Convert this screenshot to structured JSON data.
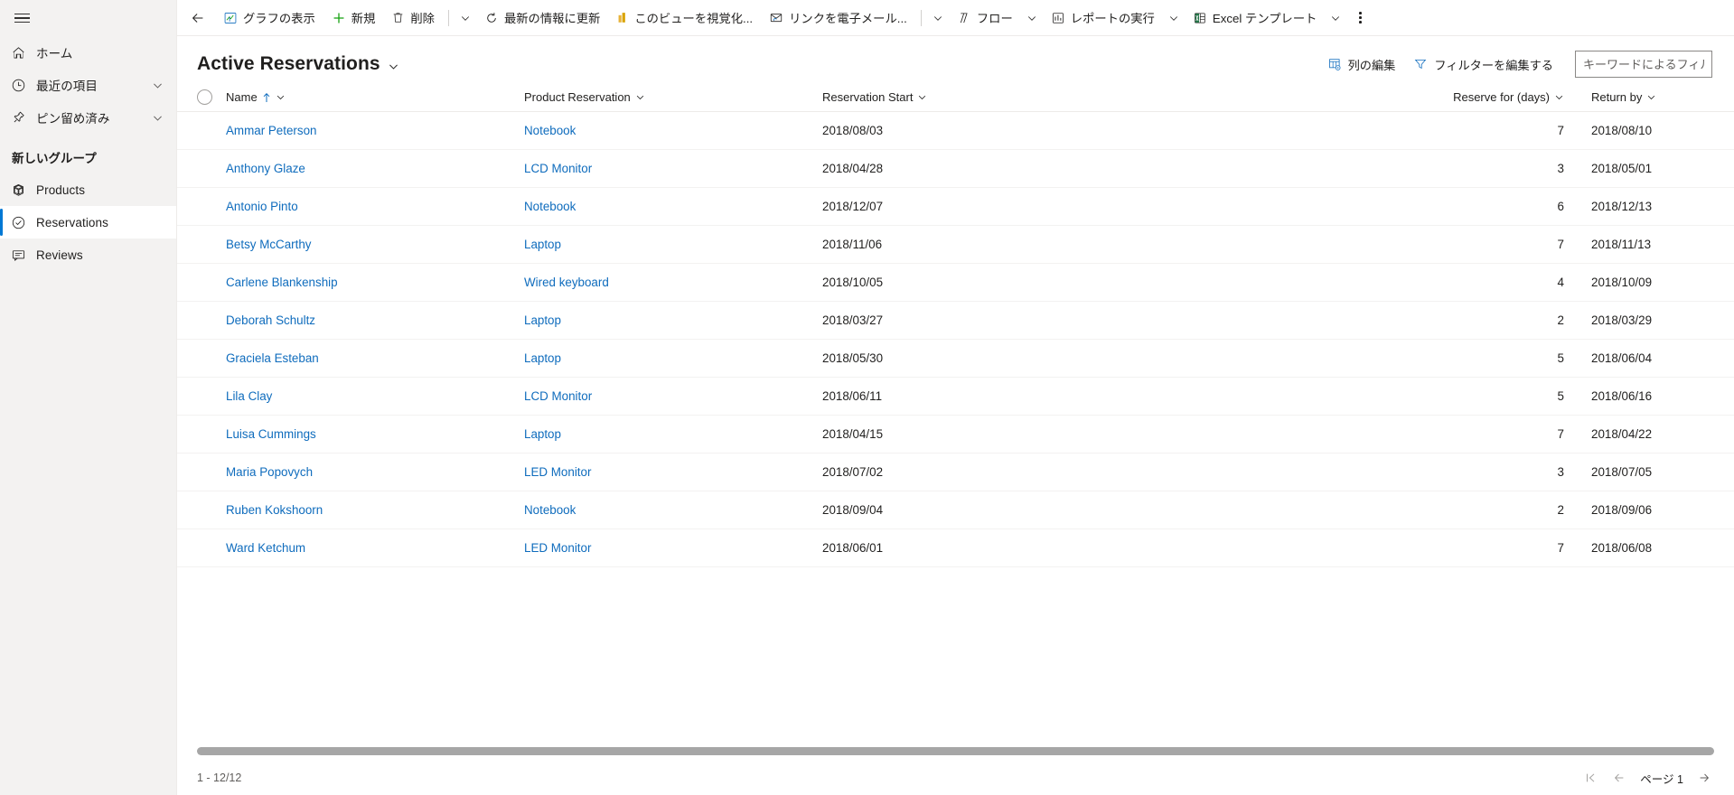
{
  "sidebar": {
    "hamburger_name": "サイト マップを表示",
    "items": [
      {
        "label": "ホーム",
        "icon": "home-icon",
        "chevron": false
      },
      {
        "label": "最近の項目",
        "icon": "clock-icon",
        "chevron": true
      },
      {
        "label": "ピン留め済み",
        "icon": "pin-icon",
        "chevron": true
      }
    ],
    "group_title": "新しいグループ",
    "group_items": [
      {
        "label": "Products",
        "icon": "box-icon",
        "selected": false
      },
      {
        "label": "Reservations",
        "icon": "check-circle-icon",
        "selected": true
      },
      {
        "label": "Reviews",
        "icon": "comment-icon",
        "selected": false
      }
    ]
  },
  "commandbar": {
    "back_icon": "back-arrow-icon",
    "buttons": [
      {
        "label": "グラフの表示",
        "icon": "chart-icon",
        "caret": false
      },
      {
        "label": "新規",
        "icon": "plus-icon",
        "caret": false
      },
      {
        "label": "削除",
        "icon": "trash-icon",
        "caret": true,
        "sep_before_caret": true
      },
      {
        "label": "最新の情報に更新",
        "icon": "refresh-icon",
        "caret": false
      },
      {
        "label": "このビューを視覚化...",
        "icon": "visualize-icon",
        "caret": false
      },
      {
        "label": "リンクを電子メール...",
        "icon": "email-link-icon",
        "caret": true,
        "sep_before_caret": true
      },
      {
        "label": "フロー",
        "icon": "flow-icon",
        "caret": true
      },
      {
        "label": "レポートの実行",
        "icon": "report-icon",
        "caret": true
      },
      {
        "label": "Excel テンプレート",
        "icon": "excel-icon",
        "caret": true
      }
    ],
    "overflow_label": "詳細コマンド"
  },
  "view": {
    "title": "Active Reservations",
    "edit_columns_label": "列の編集",
    "edit_filters_label": "フィルターを編集する",
    "filter_placeholder": "キーワードによるフィルター",
    "filter_value": ""
  },
  "grid": {
    "select_all_name": "すべて選択",
    "columns": [
      {
        "key": "name",
        "label": "Name",
        "sorted": true,
        "sort_dir": "asc"
      },
      {
        "key": "product",
        "label": "Product Reservation",
        "sorted": false
      },
      {
        "key": "start",
        "label": "Reservation Start",
        "sorted": false
      },
      {
        "key": "days",
        "label": "Reserve for (days)",
        "sorted": false
      },
      {
        "key": "return",
        "label": "Return by",
        "sorted": false
      }
    ],
    "rows": [
      {
        "name": "Ammar Peterson",
        "product": "Notebook",
        "start": "2018/08/03",
        "days": "7",
        "return": "2018/08/10"
      },
      {
        "name": "Anthony Glaze",
        "product": "LCD Monitor",
        "start": "2018/04/28",
        "days": "3",
        "return": "2018/05/01"
      },
      {
        "name": "Antonio Pinto",
        "product": "Notebook",
        "start": "2018/12/07",
        "days": "6",
        "return": "2018/12/13"
      },
      {
        "name": "Betsy McCarthy",
        "product": "Laptop",
        "start": "2018/11/06",
        "days": "7",
        "return": "2018/11/13"
      },
      {
        "name": "Carlene Blankenship",
        "product": "Wired keyboard",
        "start": "2018/10/05",
        "days": "4",
        "return": "2018/10/09"
      },
      {
        "name": "Deborah Schultz",
        "product": "Laptop",
        "start": "2018/03/27",
        "days": "2",
        "return": "2018/03/29"
      },
      {
        "name": "Graciela Esteban",
        "product": "Laptop",
        "start": "2018/05/30",
        "days": "5",
        "return": "2018/06/04"
      },
      {
        "name": "Lila Clay",
        "product": "LCD Monitor",
        "start": "2018/06/11",
        "days": "5",
        "return": "2018/06/16"
      },
      {
        "name": "Luisa Cummings",
        "product": "Laptop",
        "start": "2018/04/15",
        "days": "7",
        "return": "2018/04/22"
      },
      {
        "name": "Maria Popovych",
        "product": "LED Monitor",
        "start": "2018/07/02",
        "days": "3",
        "return": "2018/07/05"
      },
      {
        "name": "Ruben Kokshoorn",
        "product": "Notebook",
        "start": "2018/09/04",
        "days": "2",
        "return": "2018/09/06"
      },
      {
        "name": "Ward Ketchum",
        "product": "LED Monitor",
        "start": "2018/06/01",
        "days": "7",
        "return": "2018/06/08"
      }
    ]
  },
  "footer": {
    "record_count": "1 - 12/12",
    "page_label": "ページ",
    "page_number": "1",
    "first_page_name": "最初のページ",
    "previous_page_name": "前のページ",
    "next_page_name": "次のページ"
  },
  "colors": {
    "accent": "#0078d4",
    "link": "#0f6cbd",
    "sidebar_bg": "#f3f2f1",
    "new_green": "#13a10e",
    "excel_green": "#217346",
    "visualize_gold": "#d9a300"
  }
}
